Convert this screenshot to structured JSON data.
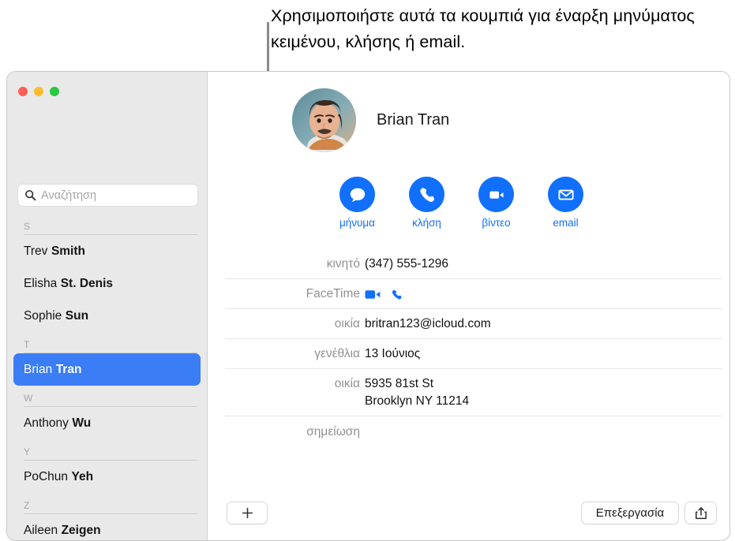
{
  "annotation": {
    "text": "Χρησιμοποιήστε αυτά τα κουμπιά για έναρξη μηνύματος κειμένου, κλήσης ή email."
  },
  "window": {
    "traffic_lights": [
      {
        "name": "close",
        "color": "#ff5f57"
      },
      {
        "name": "minimize",
        "color": "#febc2e"
      },
      {
        "name": "zoom",
        "color": "#28c840"
      }
    ]
  },
  "sidebar": {
    "search": {
      "placeholder": "Αναζήτηση",
      "value": "",
      "icon": "search-icon"
    },
    "sections": [
      {
        "letter": "S",
        "contacts": [
          {
            "first": "Trev",
            "last": "Smith",
            "selected": false
          },
          {
            "first": "Elisha",
            "last": "St. Denis",
            "selected": false
          },
          {
            "first": "Sophie",
            "last": "Sun",
            "selected": false
          }
        ]
      },
      {
        "letter": "T",
        "contacts": [
          {
            "first": "Brian",
            "last": "Tran",
            "selected": true
          }
        ]
      },
      {
        "letter": "W",
        "contacts": [
          {
            "first": "Anthony",
            "last": "Wu",
            "selected": false
          }
        ]
      },
      {
        "letter": "Y",
        "contacts": [
          {
            "first": "PoChun",
            "last": "Yeh",
            "selected": false
          }
        ]
      },
      {
        "letter": "Z",
        "contacts": [
          {
            "first": "Aileen",
            "last": "Zeigen",
            "selected": false
          }
        ]
      }
    ]
  },
  "contact": {
    "name": "Brian Tran",
    "avatar_icon": "contact-photo",
    "accent_color": "#1070fb",
    "actions": [
      {
        "icon": "message-bubble-icon",
        "label": "μήνυμα"
      },
      {
        "icon": "phone-icon",
        "label": "κλήση"
      },
      {
        "icon": "video-camera-icon",
        "label": "βίντεο"
      },
      {
        "icon": "envelope-icon",
        "label": "email"
      }
    ],
    "fields": [
      {
        "label": "κινητό",
        "value": "(347) 555-1296",
        "type": "text"
      },
      {
        "label": "FaceTime",
        "value": "",
        "type": "icons",
        "icons": [
          "video-camera-icon",
          "phone-icon"
        ]
      },
      {
        "label": "οικία",
        "value": "britran123@icloud.com",
        "type": "text"
      },
      {
        "label": "γενέθλια",
        "value": "13 Ιούνιος",
        "type": "text"
      },
      {
        "label": "οικία",
        "value": "5935 81st St\nBrooklyn NY 11214",
        "type": "text"
      },
      {
        "label": "σημείωση",
        "value": "",
        "type": "text"
      }
    ]
  },
  "toolbar": {
    "add_label": "+",
    "edit_label": "Επεξεργασία",
    "share_icon": "share-icon"
  }
}
